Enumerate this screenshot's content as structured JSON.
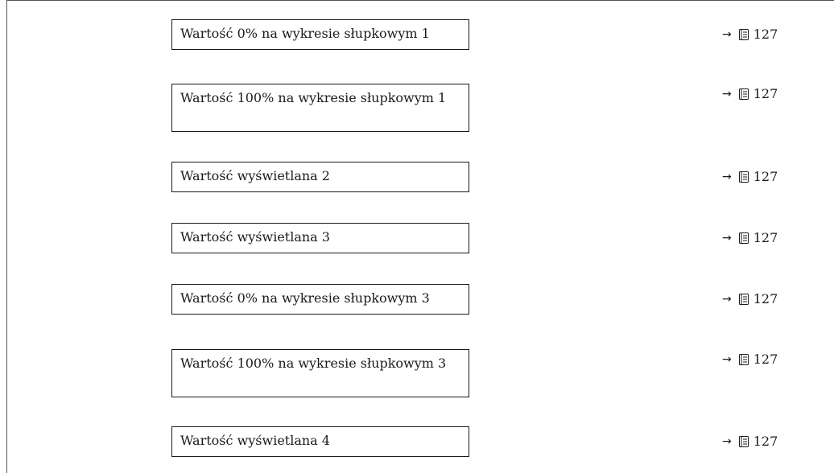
{
  "rows": [
    {
      "label": "Wartość 0% na wykresie słupkowym 1",
      "ref_arrow": "→",
      "page": "127"
    },
    {
      "label": "Wartość 100% na wykresie słupkowym 1",
      "ref_arrow": "→",
      "page": "127"
    },
    {
      "label": "Wartość wyświetlana 2",
      "ref_arrow": "→",
      "page": "127"
    },
    {
      "label": "Wartość wyświetlana 3",
      "ref_arrow": "→",
      "page": "127"
    },
    {
      "label": "Wartość 0% na wykresie słupkowym 3",
      "ref_arrow": "→",
      "page": "127"
    },
    {
      "label": "Wartość 100% na wykresie słupkowym 3",
      "ref_arrow": "→",
      "page": "127"
    },
    {
      "label": "Wartość wyświetlana 4",
      "ref_arrow": "→",
      "page": "127"
    }
  ],
  "icons": {
    "page_reference": "book-icon"
  }
}
